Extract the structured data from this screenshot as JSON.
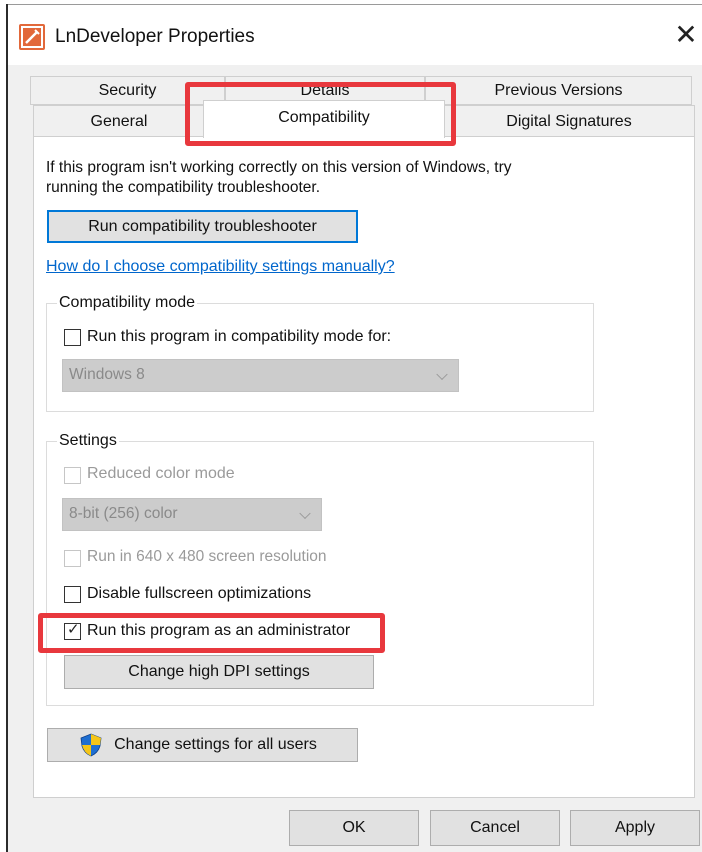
{
  "window": {
    "title": "LnDeveloper Properties",
    "close_glyph": "✕",
    "app_icon": "app-icon"
  },
  "tabs": {
    "back_row": [
      "Security",
      "Details",
      "Previous Versions"
    ],
    "front_row": [
      "General",
      "Compatibility",
      "Digital Signatures"
    ],
    "active": "Compatibility"
  },
  "intro": {
    "line1": "If this program isn't working correctly on this version of Windows, try",
    "line2": "running the compatibility troubleshooter."
  },
  "troubleshooter_button": "Run compatibility troubleshooter",
  "manual_link": "How do I choose compatibility settings manually?",
  "compat_mode": {
    "legend": "Compatibility mode",
    "checkbox_label": "Run this program in compatibility mode for:",
    "checked": false,
    "select_value": "Windows 8"
  },
  "settings": {
    "legend": "Settings",
    "reduced_color": {
      "label": "Reduced color mode",
      "checked": false,
      "enabled": false
    },
    "color_select_value": "8-bit (256) color",
    "res_640": {
      "label": "Run in 640 x 480 screen resolution",
      "checked": false,
      "enabled": false
    },
    "fullscreen_opt": {
      "label": "Disable fullscreen optimizations",
      "checked": false
    },
    "run_as_admin": {
      "label": "Run this program as an administrator",
      "checked": true,
      "check_glyph": "✓"
    },
    "dpi_button": "Change high DPI settings"
  },
  "all_users_button": "Change settings for all users",
  "all_users_icon": "uac-shield-icon",
  "footer": {
    "ok": "OK",
    "cancel": "Cancel",
    "apply": "Apply"
  },
  "colors": {
    "highlight": "#e8383d",
    "accent": "#0078d7",
    "link": "#0066cc"
  }
}
